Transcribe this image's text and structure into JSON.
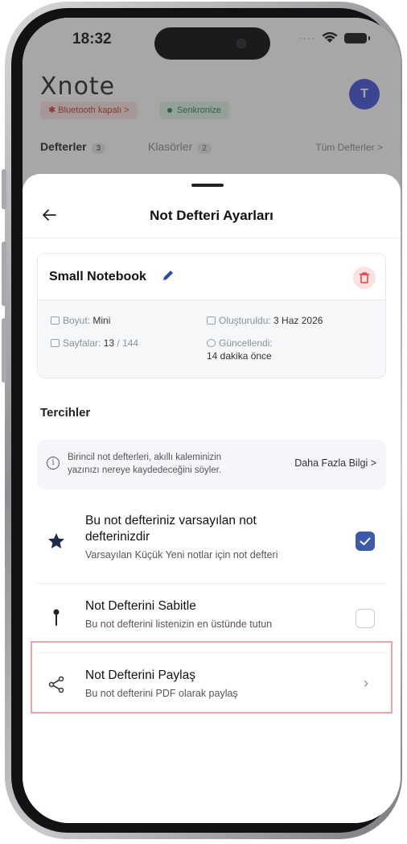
{
  "status_bar": {
    "time": "18:32"
  },
  "background_app": {
    "brand": "Xnote",
    "avatar_initial": "T",
    "bluetooth_chip": "Bluetooth kapalı >",
    "sync_chip": "Senkronize",
    "tabs": [
      {
        "label": "Defterler",
        "count": "3"
      },
      {
        "label": "Klasörler",
        "count": "2"
      }
    ],
    "all_link": "Tüm Defterler >"
  },
  "sheet": {
    "title": "Not Defteri Ayarları",
    "notebook": {
      "name": "Small Notebook",
      "size_label": "Boyut:",
      "size_value": "Mini",
      "created_label": "Oluşturuldu:",
      "created_value": "3 Haz 2026",
      "pages_label": "Sayfalar:",
      "pages_value": "13",
      "pages_total": "/ 144",
      "updated_label": "Güncellendi:",
      "updated_value": "14 dakika önce"
    },
    "preferences_title": "Tercihler",
    "info": {
      "text": "Birincil not defterleri, akıllı kaleminizin yazınızı nereye kaydedeceğini söyler.",
      "link": "Daha Fazla Bilgi >"
    },
    "options": [
      {
        "title_line1": "Bu not defteriniz varsayılan not",
        "title_line2": "defterinizdir",
        "subtitle": "Varsayılan Küçük Yeni notlar için not defteri",
        "checked": true,
        "icon": "star-icon"
      },
      {
        "title": "Not Defterini Sabitle",
        "subtitle": "Bu not defterini listenizin en üstünde tutun",
        "checked": false,
        "icon": "pin-icon"
      },
      {
        "title": "Not Defterini Paylaş",
        "subtitle": "Bu not defterini PDF olarak paylaş",
        "icon": "share-icon"
      }
    ]
  },
  "colors": {
    "accent": "#3c5aa8",
    "avatar": "#3b4ed8",
    "danger_bg": "#fde1e1",
    "highlight": "#e8a4a8"
  }
}
